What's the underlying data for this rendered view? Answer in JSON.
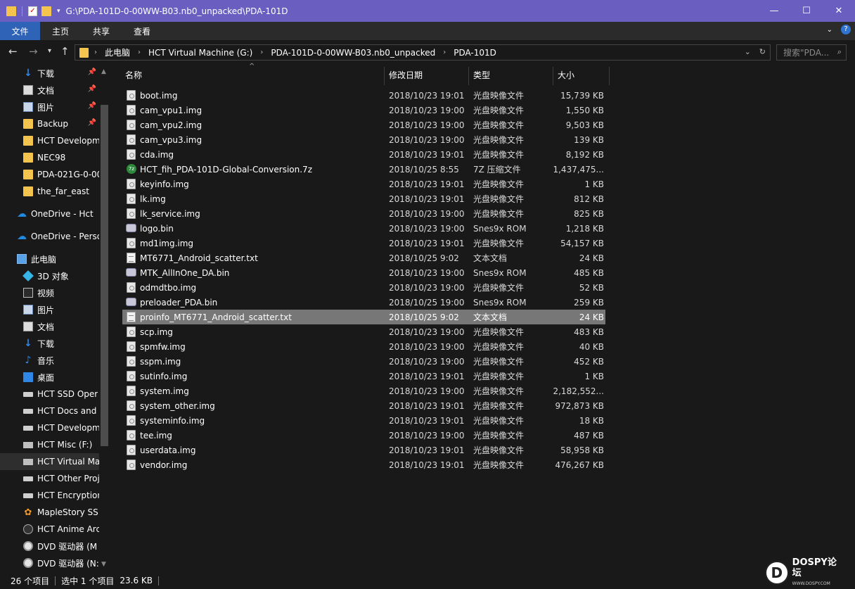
{
  "window": {
    "title": "G:\\PDA-101D-0-00WW-B03.nb0_unpacked\\PDA-101D",
    "controls": {
      "minimize": "—",
      "maximize": "☐",
      "close": "✕"
    }
  },
  "ribbon": {
    "tabs": [
      "文件",
      "主页",
      "共享",
      "查看"
    ]
  },
  "address": {
    "crumbs": [
      "此电脑",
      "HCT Virtual Machine (G:)",
      "PDA-101D-0-00WW-B03.nb0_unpacked",
      "PDA-101D"
    ],
    "search_placeholder": "搜索\"PDA..."
  },
  "sidebar": {
    "quick_access": [
      {
        "label": "下载",
        "icon": "download-icon",
        "pinned": true
      },
      {
        "label": "文档",
        "icon": "document-icon",
        "pinned": true
      },
      {
        "label": "图片",
        "icon": "picture-icon",
        "pinned": true
      },
      {
        "label": "Backup",
        "icon": "folder-icon",
        "pinned": true
      },
      {
        "label": "HCT Developm",
        "icon": "folder-icon",
        "pinned": false
      },
      {
        "label": "NEC98",
        "icon": "folder-icon",
        "pinned": false
      },
      {
        "label": "PDA-021G-0-00",
        "icon": "folder-icon",
        "pinned": false
      },
      {
        "label": "the_far_east",
        "icon": "folder-icon",
        "pinned": false
      }
    ],
    "onedrive": [
      {
        "label": "OneDrive - Hct",
        "icon": "onedrive-icon"
      },
      {
        "label": "OneDrive - Perso",
        "icon": "onedrive-icon"
      }
    ],
    "this_pc": {
      "label": "此电脑",
      "icon": "computer-icon"
    },
    "pc_items": [
      {
        "label": "3D 对象",
        "icon": "3d-objects-icon"
      },
      {
        "label": "视频",
        "icon": "video-icon"
      },
      {
        "label": "图片",
        "icon": "picture-icon"
      },
      {
        "label": "文档",
        "icon": "document-icon"
      },
      {
        "label": "下载",
        "icon": "download-icon"
      },
      {
        "label": "音乐",
        "icon": "music-icon"
      },
      {
        "label": "桌面",
        "icon": "desktop-icon"
      },
      {
        "label": "HCT SSD Oper",
        "icon": "drive-icon"
      },
      {
        "label": "HCT Docs and",
        "icon": "drive-icon"
      },
      {
        "label": "HCT Developm",
        "icon": "drive-icon"
      },
      {
        "label": "HCT Misc (F:)",
        "icon": "network-drive-icon"
      },
      {
        "label": "HCT Virtual Ma",
        "icon": "network-drive-icon",
        "active": true
      },
      {
        "label": "HCT Other Proj",
        "icon": "drive-icon"
      },
      {
        "label": "HCT Encryption",
        "icon": "drive-icon"
      },
      {
        "label": "MapleStory SS",
        "icon": "maplestory-icon"
      },
      {
        "label": "HCT Anime Arc",
        "icon": "anime-drive-icon"
      },
      {
        "label": "DVD 驱动器 (M",
        "icon": "dvd-icon"
      },
      {
        "label": "DVD 驱动器 (N:",
        "icon": "dvd-icon"
      }
    ]
  },
  "columns": {
    "name": "名称",
    "date": "修改日期",
    "type": "类型",
    "size": "大小"
  },
  "files": [
    {
      "name": "boot.img",
      "date": "2018/10/23 19:01",
      "type": "光盘映像文件",
      "size": "15,739 KB",
      "icon": "disc-image-icon"
    },
    {
      "name": "cam_vpu1.img",
      "date": "2018/10/23 19:00",
      "type": "光盘映像文件",
      "size": "1,550 KB",
      "icon": "disc-image-icon"
    },
    {
      "name": "cam_vpu2.img",
      "date": "2018/10/23 19:00",
      "type": "光盘映像文件",
      "size": "9,503 KB",
      "icon": "disc-image-icon"
    },
    {
      "name": "cam_vpu3.img",
      "date": "2018/10/23 19:00",
      "type": "光盘映像文件",
      "size": "139 KB",
      "icon": "disc-image-icon"
    },
    {
      "name": "cda.img",
      "date": "2018/10/23 19:01",
      "type": "光盘映像文件",
      "size": "8,192 KB",
      "icon": "disc-image-icon"
    },
    {
      "name": "HCT_fih_PDA-101D-Global-Conversion.7z",
      "date": "2018/10/25 8:55",
      "type": "7Z 压缩文件",
      "size": "1,437,475...",
      "icon": "7z-archive-icon"
    },
    {
      "name": "keyinfo.img",
      "date": "2018/10/23 19:01",
      "type": "光盘映像文件",
      "size": "1 KB",
      "icon": "disc-image-icon"
    },
    {
      "name": "lk.img",
      "date": "2018/10/23 19:01",
      "type": "光盘映像文件",
      "size": "812 KB",
      "icon": "disc-image-icon"
    },
    {
      "name": "lk_service.img",
      "date": "2018/10/23 19:00",
      "type": "光盘映像文件",
      "size": "825 KB",
      "icon": "disc-image-icon"
    },
    {
      "name": "logo.bin",
      "date": "2018/10/23 19:00",
      "type": "Snes9x ROM",
      "size": "1,218 KB",
      "icon": "snes-rom-icon"
    },
    {
      "name": "md1img.img",
      "date": "2018/10/23 19:01",
      "type": "光盘映像文件",
      "size": "54,157 KB",
      "icon": "disc-image-icon"
    },
    {
      "name": "MT6771_Android_scatter.txt",
      "date": "2018/10/25 9:02",
      "type": "文本文档",
      "size": "24 KB",
      "icon": "text-file-icon"
    },
    {
      "name": "MTK_AllInOne_DA.bin",
      "date": "2018/10/23 19:00",
      "type": "Snes9x ROM",
      "size": "485 KB",
      "icon": "snes-rom-icon"
    },
    {
      "name": "odmdtbo.img",
      "date": "2018/10/23 19:00",
      "type": "光盘映像文件",
      "size": "52 KB",
      "icon": "disc-image-icon"
    },
    {
      "name": "preloader_PDA.bin",
      "date": "2018/10/25 19:00",
      "type": "Snes9x ROM",
      "size": "259 KB",
      "icon": "snes-rom-icon"
    },
    {
      "name": "proinfo_MT6771_Android_scatter.txt",
      "date": "2018/10/25 9:02",
      "type": "文本文档",
      "size": "24 KB",
      "icon": "text-file-icon",
      "selected": true
    },
    {
      "name": "scp.img",
      "date": "2018/10/23 19:00",
      "type": "光盘映像文件",
      "size": "483 KB",
      "icon": "disc-image-icon"
    },
    {
      "name": "spmfw.img",
      "date": "2018/10/23 19:00",
      "type": "光盘映像文件",
      "size": "40 KB",
      "icon": "disc-image-icon"
    },
    {
      "name": "sspm.img",
      "date": "2018/10/23 19:00",
      "type": "光盘映像文件",
      "size": "452 KB",
      "icon": "disc-image-icon"
    },
    {
      "name": "sutinfo.img",
      "date": "2018/10/23 19:01",
      "type": "光盘映像文件",
      "size": "1 KB",
      "icon": "disc-image-icon"
    },
    {
      "name": "system.img",
      "date": "2018/10/23 19:00",
      "type": "光盘映像文件",
      "size": "2,182,552...",
      "icon": "disc-image-icon"
    },
    {
      "name": "system_other.img",
      "date": "2018/10/23 19:01",
      "type": "光盘映像文件",
      "size": "972,873 KB",
      "icon": "disc-image-icon"
    },
    {
      "name": "systeminfo.img",
      "date": "2018/10/23 19:01",
      "type": "光盘映像文件",
      "size": "18 KB",
      "icon": "disc-image-icon"
    },
    {
      "name": "tee.img",
      "date": "2018/10/23 19:00",
      "type": "光盘映像文件",
      "size": "487 KB",
      "icon": "disc-image-icon"
    },
    {
      "name": "userdata.img",
      "date": "2018/10/23 19:01",
      "type": "光盘映像文件",
      "size": "58,958 KB",
      "icon": "disc-image-icon"
    },
    {
      "name": "vendor.img",
      "date": "2018/10/23 19:01",
      "type": "光盘映像文件",
      "size": "476,267 KB",
      "icon": "disc-image-icon"
    }
  ],
  "status": {
    "item_count": "26 个项目",
    "selection": "选中 1 个项目",
    "selection_size": "23.6 KB"
  },
  "watermark": {
    "text": "DOSPY论坛",
    "logo_letter": "D",
    "sub": "WWW.DOSPY.COM"
  },
  "colors": {
    "titlebar": "#6a5fc1",
    "active_tab": "#2f63b7",
    "selected_row": "#777777",
    "background": "#191919"
  }
}
